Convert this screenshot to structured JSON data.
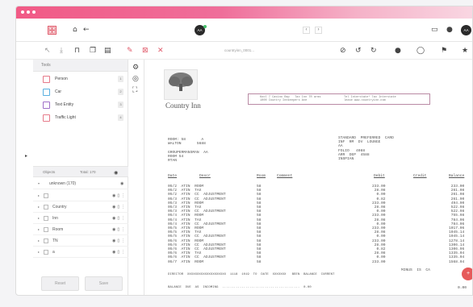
{
  "app": {
    "avatar_center": "AA",
    "avatar_right": "AA",
    "filename": "countryinn_0001...",
    "colors": {
      "accent": "#f15a86",
      "fab": "#e65a5a"
    }
  },
  "tools": {
    "header": "Tools",
    "items": [
      {
        "label": "Person",
        "shortcut": "1",
        "color": "#e67a8a"
      },
      {
        "label": "Car",
        "shortcut": "2",
        "color": "#5ab0e0"
      },
      {
        "label": "Text Entity",
        "shortcut": "3",
        "color": "#a070c8"
      },
      {
        "label": "Traffic Light",
        "shortcut": "4",
        "color": "#e67a8a"
      }
    ]
  },
  "objects": {
    "header": "Objects",
    "total": "Total: 170",
    "group": "unknown (170)",
    "rows": [
      {
        "label": ""
      },
      {
        "label": "Country"
      },
      {
        "label": "Inn"
      },
      {
        "label": "Room"
      },
      {
        "label": "TN"
      },
      {
        "label": "a"
      }
    ]
  },
  "buttons": {
    "reset": "Reset",
    "save": "Save"
  },
  "document": {
    "logo_text": "Country Inn",
    "header_box_left": "Kool 7 Casino Rap   Tax Inn TR arms\n1000 Country Innkeepers Ave",
    "header_box_right": "Tel Interstate* Tax Interstate\nlease www.countryinn.com",
    "guest_block": "ROOM: 58       A\nWALTON       5688\n\nGROUPERMANSMAN  AA\nROOM 54\nRTAN",
    "right_block": "STANDARD  PREFERRED  CARD\nINF  RM  DV  LOUNGE\nAA\nFOLIO   4088\nARR  DEP  4588\nINSPIAN",
    "columns": {
      "date": "Date",
      "descr": "Descr",
      "room": "Room",
      "comment": "Comment",
      "debit": "Debit",
      "credit": "Credit",
      "balance": "Balance"
    },
    "dates": "05/2  ATIN  ROOM\n05/2  ATIN  TAX\n05/2  ATIN  CC  ADJUSTMENT\n05/3  ATIN  CC  ADJUSTMENT\n05/3  ATIN  ROOM\n05/3  ATIN  TAX\n05/3  ATIN  CC  ADJUSTMENT\n05/4  ATIN  ROOM\n05/4  ATIN  TAX\n05/4  ATIN  CC  ADJUSTMENT\n05/5  ATIN  ROOM\n05/5  ATIN  TAX\n05/5  ATIN  CC  ADJUSTMENT\n05/6  ATIN  ROOM\n05/6  ATIN  CC  ADJUSTMENT\n05/6  ATIN  CC  ADJUSTMENT\n05/6  ATIN  TAX\n05/6  ATIN  CC  ADJUSTMENT\n05/7  ATIN  ROOM",
    "rooms": "58\n58\n58\n58\n58\n58\n58\n58\n58\n58\n58\n58\n58\n58\n58\n58\n58\n58\n58",
    "debits": "233.00\n28.08\n0.00\n0.82\n233.00\n28.08\n0.00\n233.00\n28.08\n0.00\n233.00\n28.08\n0.00\n233.00\n28.00\n0.82\n28.08\n0.00\n233.00",
    "balances": "233.00\n261.08\n261.08\n261.90\n494.90\n522.98\n522.98\n755.98\n784.06\n784.06\n1017.06\n1045.14\n1045.14\n1278.14\n1306.14\n1306.96\n1335.04\n1335.04\n1568.04",
    "footer_left": "DIRECTOR  XXXXXXXXXXXXXXXXXXXX  1118  1019  TO  DATE  XXXXXXX   BEEN  BALANCE  CURRENT",
    "footer_totals": "MINUS  IS  CA",
    "footer_line": "BALANCE  DUE  AS  INCOMING  ........................................  0.00",
    "fab_value": "0.00"
  }
}
